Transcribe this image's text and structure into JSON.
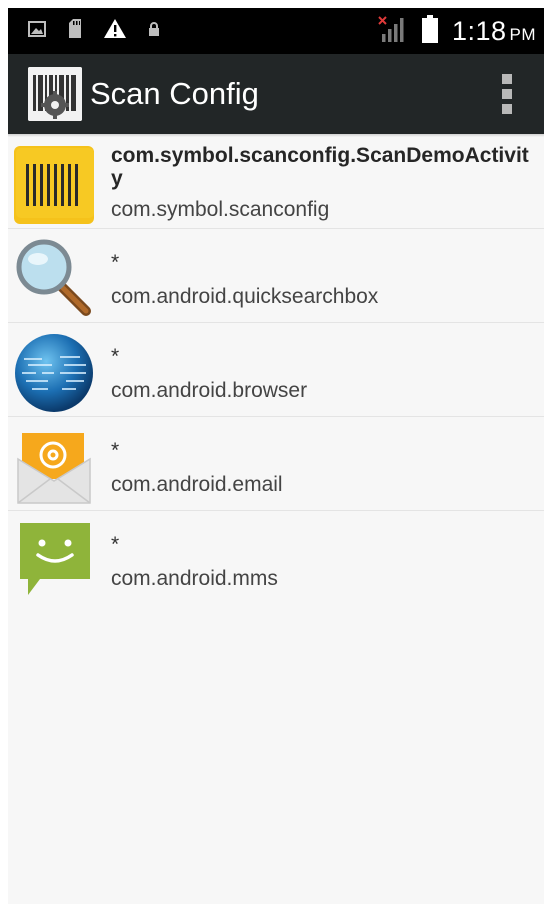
{
  "status_bar": {
    "time": "1:18",
    "ampm": "PM",
    "icons": [
      "image-icon",
      "sd-card-icon",
      "warning-icon",
      "lock-icon",
      "no-signal-icon",
      "battery-icon"
    ]
  },
  "action_bar": {
    "title": "Scan Config",
    "app_icon": "barcode-gear-icon",
    "overflow_icon": "overflow-menu-icon"
  },
  "apps": [
    {
      "icon": "barcode-icon",
      "activity": "com.symbol.scanconfig.ScanDemoActivity",
      "package": "com.symbol.scanconfig"
    },
    {
      "icon": "magnifier-icon",
      "activity": "*",
      "package": "com.android.quicksearchbox"
    },
    {
      "icon": "globe-icon",
      "activity": "*",
      "package": "com.android.browser"
    },
    {
      "icon": "email-icon",
      "activity": "*",
      "package": "com.android.email"
    },
    {
      "icon": "messaging-icon",
      "activity": "*",
      "package": "com.android.mms"
    }
  ],
  "colors": {
    "status_bar": "#000000",
    "action_bar": "#222627",
    "background": "#f7f7f7",
    "barcode_tile": "#f5c21b",
    "messaging": "#8fb43a"
  }
}
